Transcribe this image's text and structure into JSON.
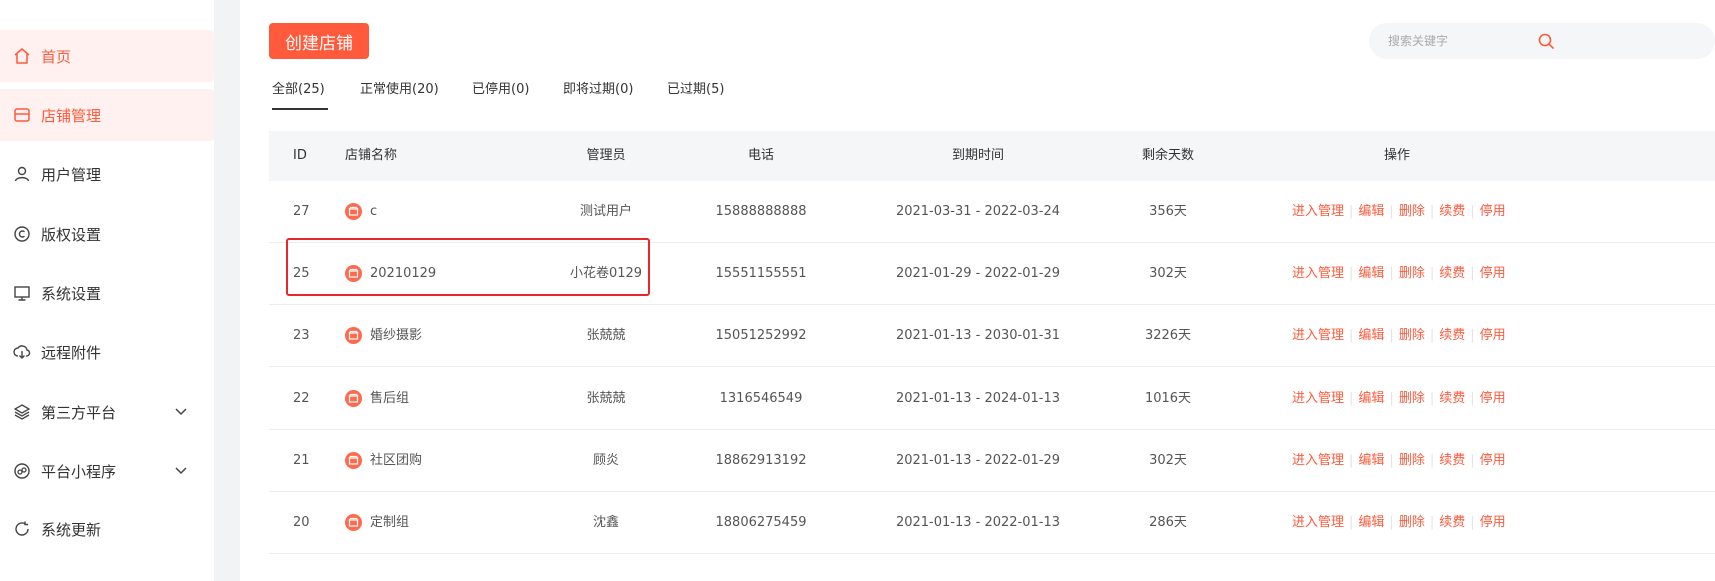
{
  "sidebar": {
    "items": [
      {
        "label": "首页",
        "icon": "home-icon"
      },
      {
        "label": "店铺管理",
        "icon": "store-icon"
      },
      {
        "label": "用户管理",
        "icon": "user-icon"
      },
      {
        "label": "版权设置",
        "icon": "copyright-icon"
      },
      {
        "label": "系统设置",
        "icon": "monitor-icon"
      },
      {
        "label": "远程附件",
        "icon": "cloud-download-icon"
      },
      {
        "label": "第三方平台",
        "icon": "layers-icon"
      },
      {
        "label": "平台小程序",
        "icon": "miniprogram-icon"
      },
      {
        "label": "系统更新",
        "icon": "update-icon"
      }
    ]
  },
  "toolbar": {
    "create_label": "创建店铺",
    "search_placeholder": "搜索关键字"
  },
  "tabs": [
    {
      "label": "全部(25)",
      "active": true
    },
    {
      "label": "正常使用(20)"
    },
    {
      "label": "已停用(0)"
    },
    {
      "label": "即将过期(0)"
    },
    {
      "label": "已过期(5)"
    }
  ],
  "table": {
    "headers": {
      "id": "ID",
      "name": "店铺名称",
      "admin": "管理员",
      "phone": "电话",
      "expire": "到期时间",
      "days": "剩余天数",
      "ops": "操作"
    },
    "rows": [
      {
        "id": "27",
        "name": "c",
        "admin": "测试用户",
        "phone": "15888888888",
        "expire": "2021-03-31 - 2022-03-24",
        "days": "356天"
      },
      {
        "id": "25",
        "name": "20210129",
        "admin": "小花卷0129",
        "phone": "15551155551",
        "expire": "2021-01-29 - 2022-01-29",
        "days": "302天"
      },
      {
        "id": "23",
        "name": "婚纱摄影",
        "admin": "张兢兢",
        "phone": "15051252992",
        "expire": "2021-01-13 - 2030-01-31",
        "days": "3226天"
      },
      {
        "id": "22",
        "name": "售后组",
        "admin": "张兢兢",
        "phone": "1316546549",
        "expire": "2021-01-13 - 2024-01-13",
        "days": "1016天"
      },
      {
        "id": "21",
        "name": "社区团购",
        "admin": "顾炎",
        "phone": "18862913192",
        "expire": "2021-01-13 - 2022-01-29",
        "days": "302天"
      },
      {
        "id": "20",
        "name": "定制组",
        "admin": "沈鑫",
        "phone": "18806275459",
        "expire": "2021-01-13 - 2022-01-13",
        "days": "286天"
      }
    ],
    "operations": [
      "进入管理",
      "编辑",
      "删除",
      "续费",
      "停用"
    ]
  },
  "colors": {
    "accent": "#ff5a3c",
    "active_bg": "#fff1ef",
    "header_bg": "#f5f6f7",
    "highlight_border": "#e8262b"
  }
}
